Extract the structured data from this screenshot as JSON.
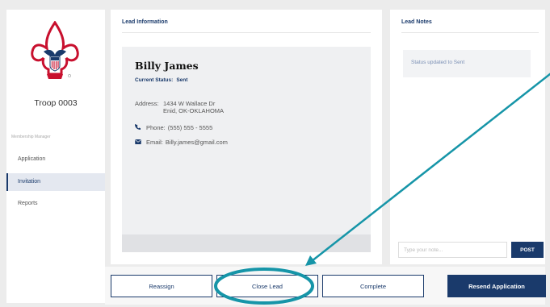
{
  "sidebar": {
    "troop_name": "Troop 0003",
    "section_caption": "Membership Manager",
    "items": [
      {
        "label": "Application"
      },
      {
        "label": "Invitation"
      },
      {
        "label": "Reports"
      }
    ],
    "active_item": "Invitation"
  },
  "lead_info": {
    "title": "Lead Information",
    "name": "Billy James",
    "status_label": "Current Status:",
    "status_value": "Sent",
    "address_label": "Address:",
    "address_line1": "1434 W Wallace Dr",
    "address_line2": "Enid, OK-OKLAHOMA",
    "phone_label": "Phone:",
    "phone_value": "(555) 555 - 5555",
    "email_label": "Email:",
    "email_value": "Billy.james@gmail.com"
  },
  "lead_notes": {
    "title": "Lead Notes",
    "note_text": "Status updated to Sent",
    "input_placeholder": "Type your note...",
    "post_label": "POST"
  },
  "actions": {
    "reassign": "Reassign",
    "close_lead": "Close Lead",
    "complete": "Complete",
    "resend": "Resend Application"
  },
  "icons": {
    "phone": "phone-icon",
    "email": "envelope-icon",
    "logo": "bsa-fleur-de-lis-logo"
  },
  "colors": {
    "navy": "#1a3a6b",
    "annotation_teal": "#1695a8",
    "logo_red": "#c8102e"
  }
}
